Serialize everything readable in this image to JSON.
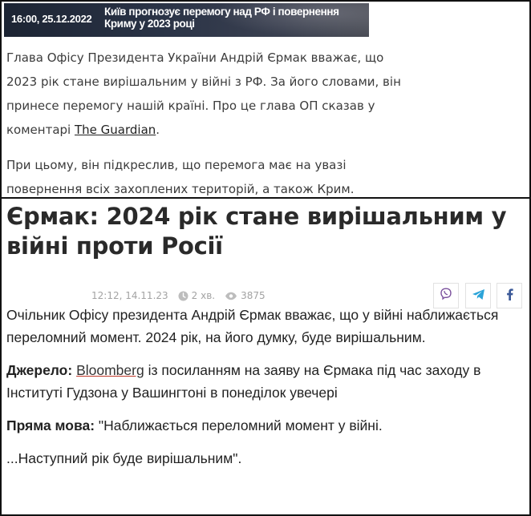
{
  "banner": {
    "datetime": "16:00, 25.12.2022",
    "title": "Київ прогнозує перемогу над РФ і повернення Криму у 2023 році"
  },
  "top_article": {
    "paragraph1": "Глава Офісу Президента України Андрій Єрмак вважає, що 2023 рік стане вирішальним у війні з РФ. За його словами, він принесе перемогу нашій країні. Про це глава ОП сказав у коментарі ",
    "link": "The Guardian",
    "paragraph1_end": ".",
    "paragraph2": "При цьому, він підкреслив, що перемога має на увазі повернення всіх захоплених територій, а також Крим."
  },
  "article": {
    "headline": "Єрмак: 2024 рік стане вирішальним у війні проти Росії",
    "meta": {
      "time": "12:12, 14.11.23",
      "read_time": "2 хв.",
      "views": "3875"
    },
    "share": {
      "viber_icon": "viber-icon",
      "telegram_icon": "telegram-icon",
      "facebook_icon": "facebook-icon"
    },
    "lead": "Очільник Офісу президента Андрій Єрмак вважає, що у війні наближається переломний момент. 2024 рік, на його думку, буде вирішальним.",
    "source_label": "Джерело:",
    "source_link": "Bloomberg",
    "source_text": " із посиланням на заяву на Єрмака під час заходу в Інституті Гудзона у Вашингтоні в понеділок увечері",
    "quote_label": "Пряма мова:",
    "quote_text": " \"Наближається переломний момент у війні.",
    "quote_cont": "...Наступний рік буде вирішальним\"."
  },
  "colors": {
    "viber": "#7b519d",
    "telegram": "#2aa3d8",
    "facebook": "#3b5998",
    "meta_gray": "#a3a3a3"
  }
}
